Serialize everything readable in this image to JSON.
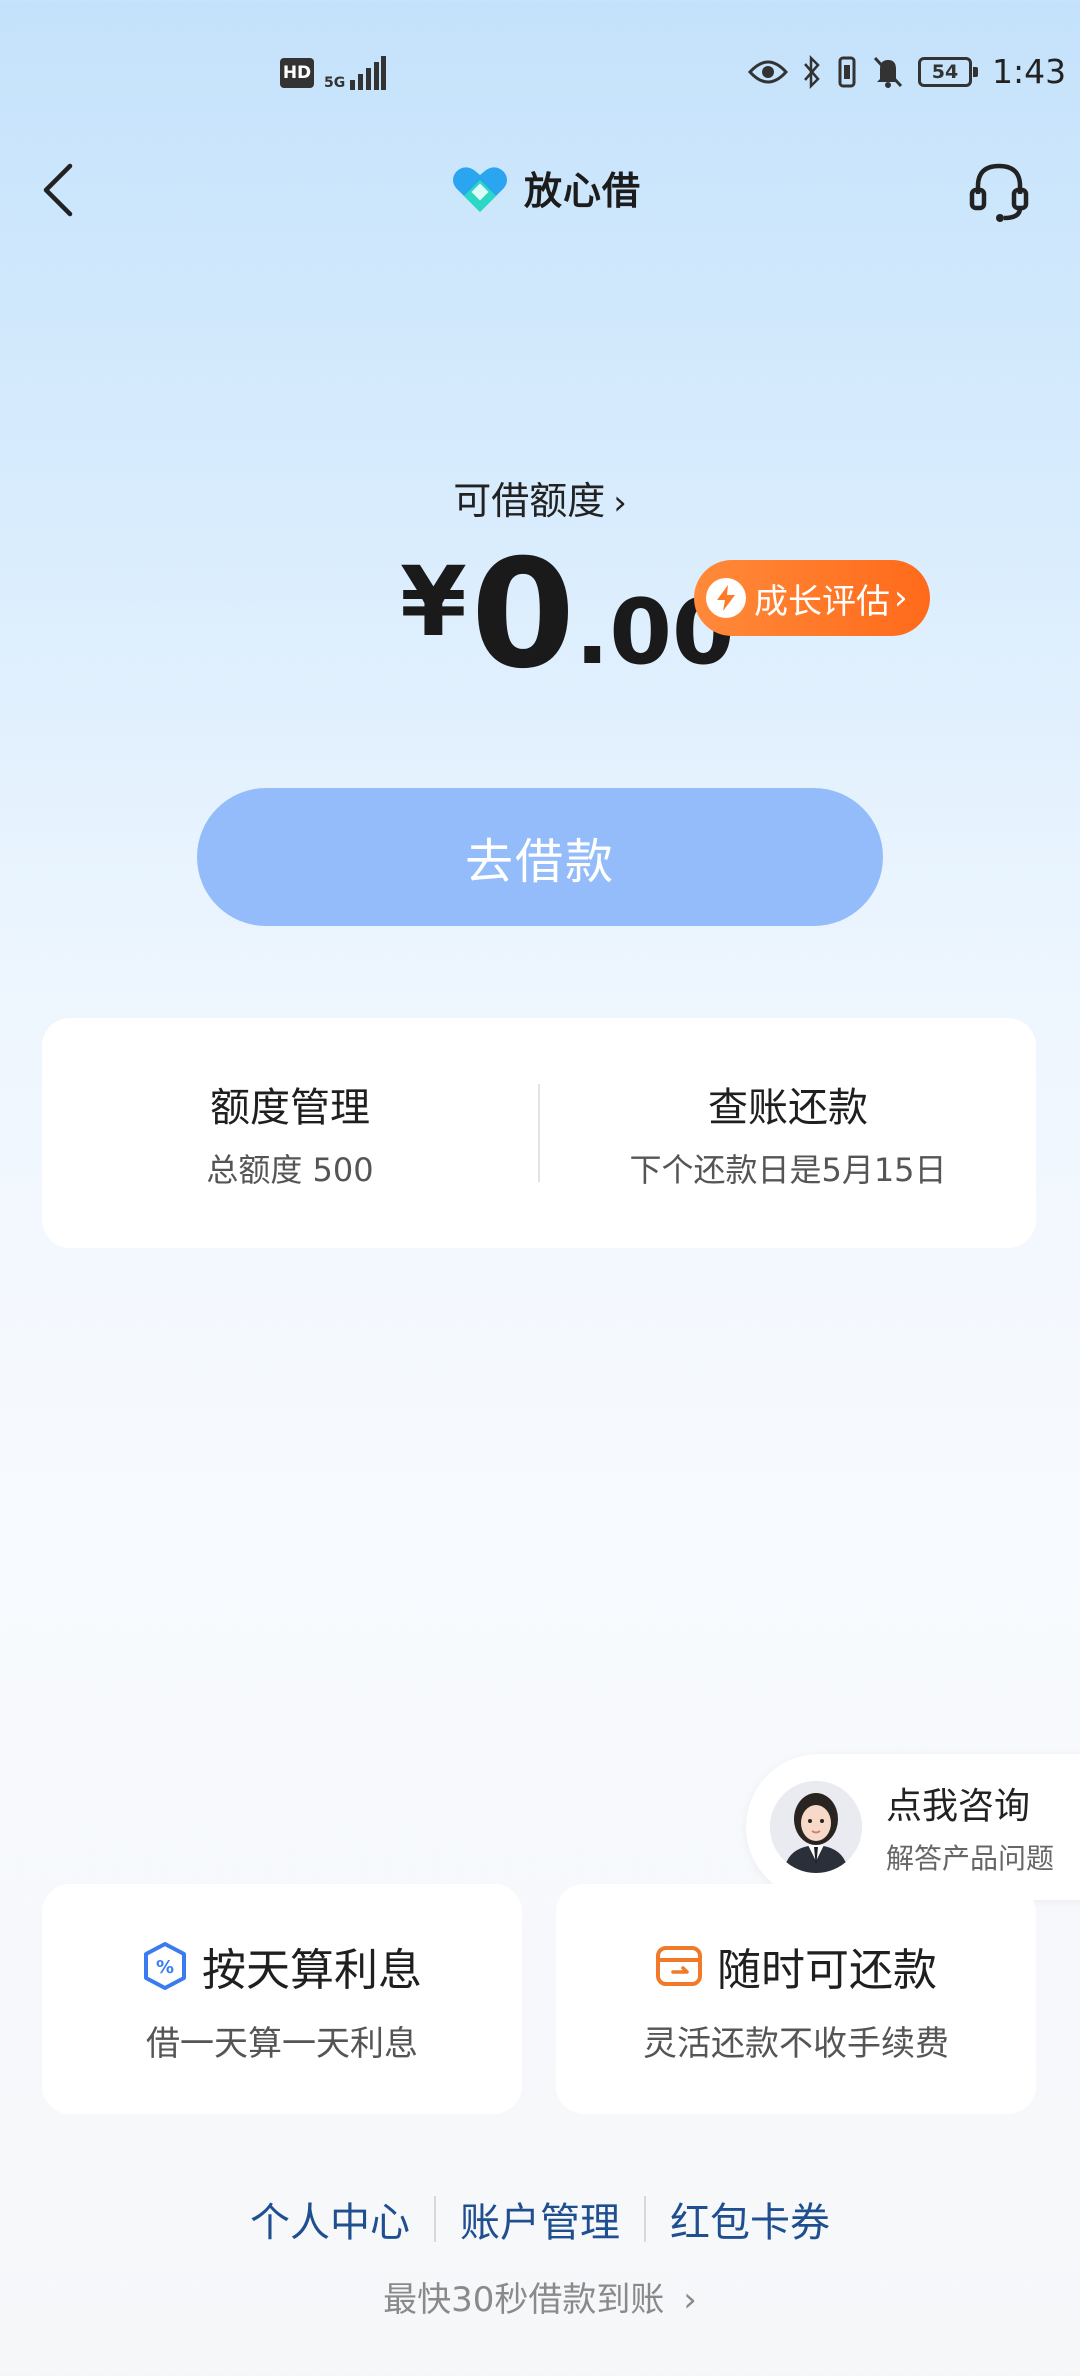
{
  "status_bar": {
    "hd": "HD",
    "network": "5G",
    "battery": "54",
    "time": "1:43"
  },
  "nav": {
    "brand_name": "放心借"
  },
  "credit": {
    "label": "可借额度",
    "currency": "¥",
    "amount_int": "0",
    "amount_dec": ".00",
    "growth_button": "成长评估",
    "borrow_button": "去借款"
  },
  "quota_card": {
    "manage_title": "额度管理",
    "manage_sub": "总额度 500",
    "repay_title": "查账还款",
    "repay_sub": "下个还款日是5月15日"
  },
  "consult": {
    "title": "点我咨询",
    "subtitle": "解答产品问题"
  },
  "features": [
    {
      "title": "按天算利息",
      "subtitle": "借一天算一天利息",
      "icon": "percent-shield-icon",
      "color": "#3a7cf0"
    },
    {
      "title": "随时可还款",
      "subtitle": "灵活还款不收手续费",
      "icon": "wallet-icon",
      "color": "#f07a2a"
    }
  ],
  "bottom_links": [
    "个人中心",
    "账户管理",
    "红包卡券"
  ],
  "tagline": "最快30秒借款到账",
  "colors": {
    "primary_button": "#94bcfa",
    "growth_button": "#ff7a28",
    "link": "#1f4f8f"
  }
}
